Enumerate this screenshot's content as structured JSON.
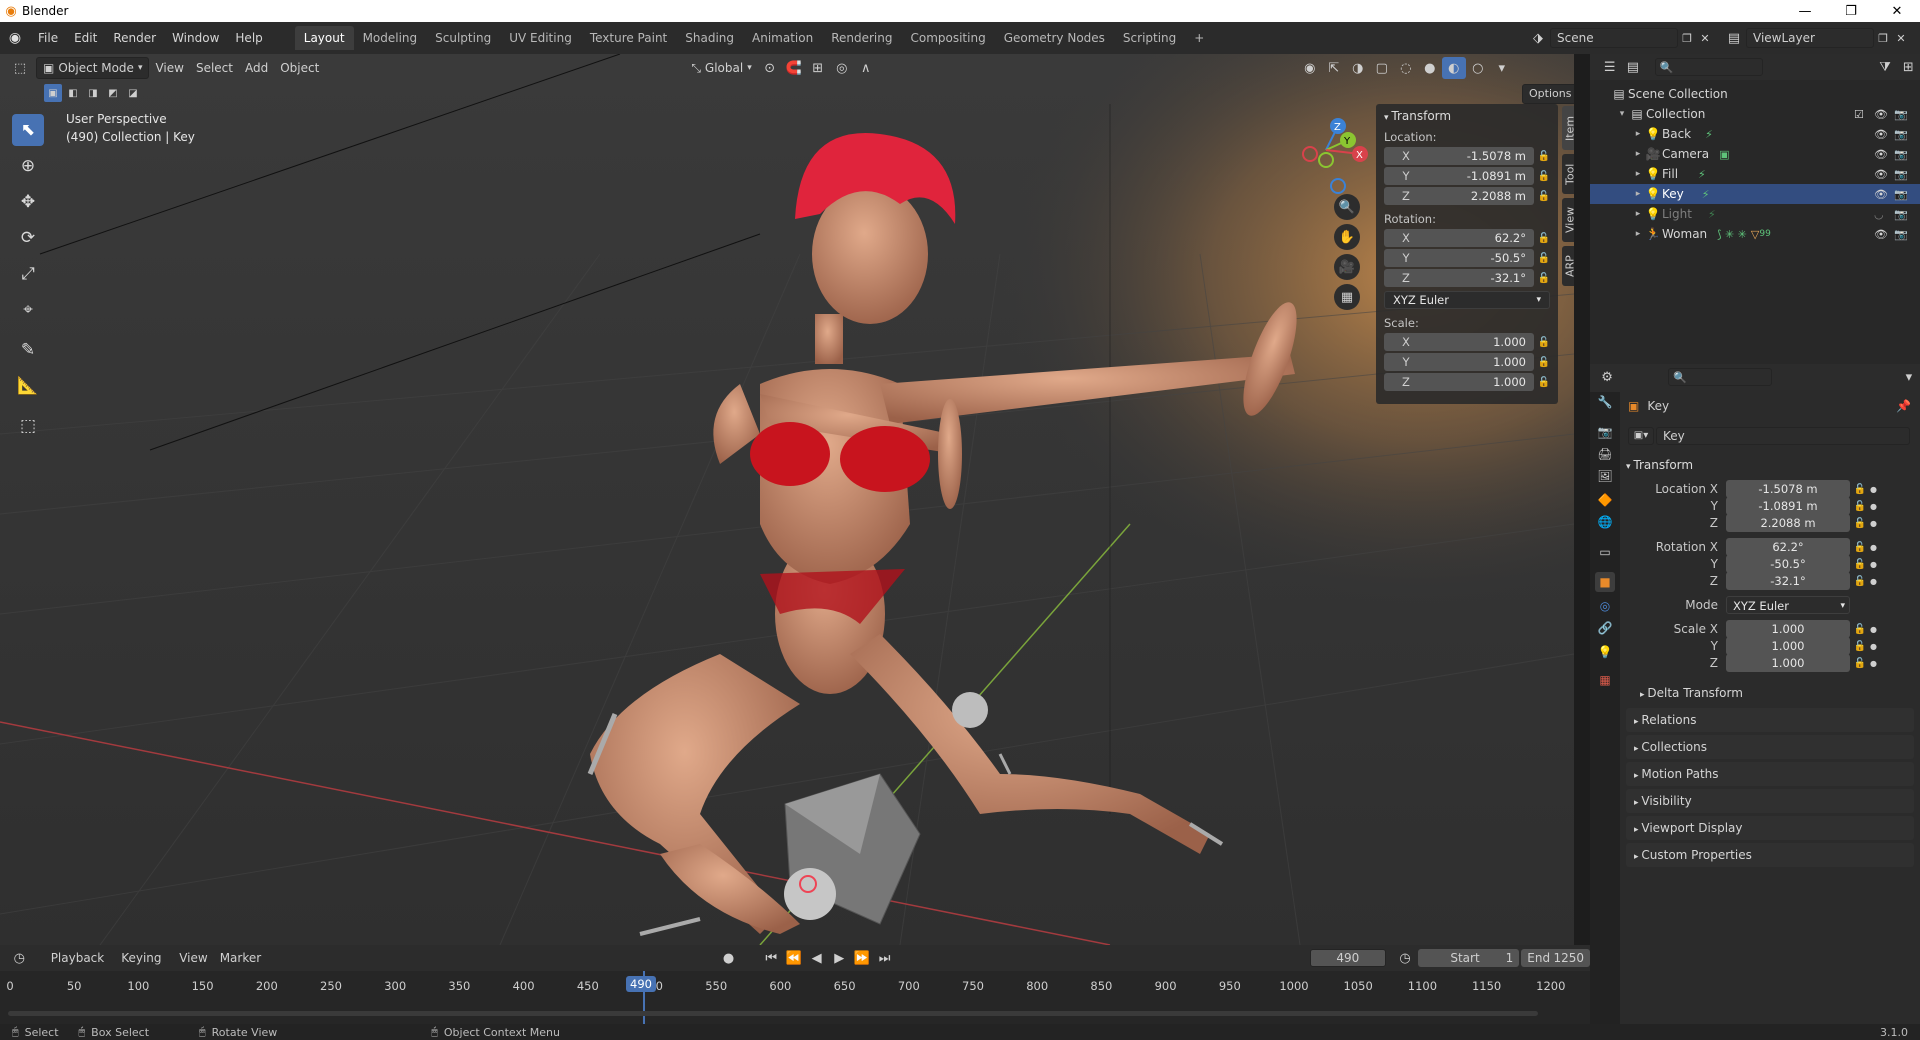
{
  "app": {
    "title": "Blender",
    "version": "3.1.0"
  },
  "menu": [
    "File",
    "Edit",
    "Render",
    "Window",
    "Help"
  ],
  "workspaces": [
    "Layout",
    "Modeling",
    "Sculpting",
    "UV Editing",
    "Texture Paint",
    "Shading",
    "Animation",
    "Rendering",
    "Compositing",
    "Geometry Nodes",
    "Scripting"
  ],
  "scene": {
    "name": "Scene",
    "view_layer": "ViewLayer"
  },
  "viewport": {
    "mode": "Object Mode",
    "menus": [
      "View",
      "Select",
      "Add",
      "Object"
    ],
    "orientation": "Global",
    "options_label": "Options",
    "info_line1": "User Perspective",
    "info_line2": "(490) Collection | Key"
  },
  "npanel": {
    "header": "Transform",
    "location_label": "Location:",
    "rotation_label": "Rotation:",
    "scale_label": "Scale:",
    "location": [
      {
        "axis": "X",
        "value": "-1.5078 m"
      },
      {
        "axis": "Y",
        "value": "-1.0891 m"
      },
      {
        "axis": "Z",
        "value": "2.2088 m"
      }
    ],
    "rotation": [
      {
        "axis": "X",
        "value": "62.2°"
      },
      {
        "axis": "Y",
        "value": "-50.5°"
      },
      {
        "axis": "Z",
        "value": "-32.1°"
      }
    ],
    "rotation_mode": "XYZ Euler",
    "scale": [
      {
        "axis": "X",
        "value": "1.000"
      },
      {
        "axis": "Y",
        "value": "1.000"
      },
      {
        "axis": "Z",
        "value": "1.000"
      }
    ],
    "tabs": [
      "Item",
      "Tool",
      "View",
      "ARP"
    ]
  },
  "outliner": {
    "root": "Scene Collection",
    "collection": "Collection",
    "items": [
      {
        "name": "Back",
        "icon": "light-icon"
      },
      {
        "name": "Camera",
        "icon": "camera-icon"
      },
      {
        "name": "Fill",
        "icon": "light-icon"
      },
      {
        "name": "Key",
        "icon": "light-icon"
      },
      {
        "name": "Light",
        "icon": "light-icon"
      },
      {
        "name": "Woman",
        "icon": "armature-icon"
      }
    ],
    "woman_badge": "99"
  },
  "properties": {
    "object_name": "Key",
    "data_name": "Key",
    "transform_header": "Transform",
    "location_x_label": "Location X",
    "rotation_x_label": "Rotation X",
    "mode_label": "Mode",
    "scale_x_label": "Scale X",
    "y_label": "Y",
    "z_label": "Z",
    "location": [
      "-1.5078 m",
      "-1.0891 m",
      "2.2088 m"
    ],
    "rotation": [
      "62.2°",
      "-50.5°",
      "-32.1°"
    ],
    "mode": "XYZ Euler",
    "scale": [
      "1.000",
      "1.000",
      "1.000"
    ],
    "sections": [
      "Delta Transform",
      "Relations",
      "Collections",
      "Motion Paths",
      "Visibility",
      "Viewport Display",
      "Custom Properties"
    ]
  },
  "timeline": {
    "menus": [
      "Playback",
      "Keying",
      "View",
      "Marker"
    ],
    "current_frame": "490",
    "start_label": "Start",
    "start": "1",
    "end_label": "End",
    "end": "1250",
    "ticks": [
      "0",
      "50",
      "100",
      "150",
      "200",
      "250",
      "300",
      "350",
      "400",
      "450",
      "500",
      "550",
      "600",
      "650",
      "700",
      "750",
      "800",
      "850",
      "900",
      "950",
      "1000",
      "1050",
      "1100",
      "1150",
      "1200"
    ]
  },
  "status": {
    "select": "Select",
    "box_select": "Box Select",
    "rotate_view": "Rotate View",
    "context_menu": "Object Context Menu"
  },
  "colors": {
    "accent": "#4772b3",
    "x_axis": "#d8424b",
    "y_axis": "#8bc531",
    "z_axis": "#3b82d6",
    "viewport_bg": "#393939",
    "bikini": "#c8141e",
    "hair": "#e0243c"
  }
}
